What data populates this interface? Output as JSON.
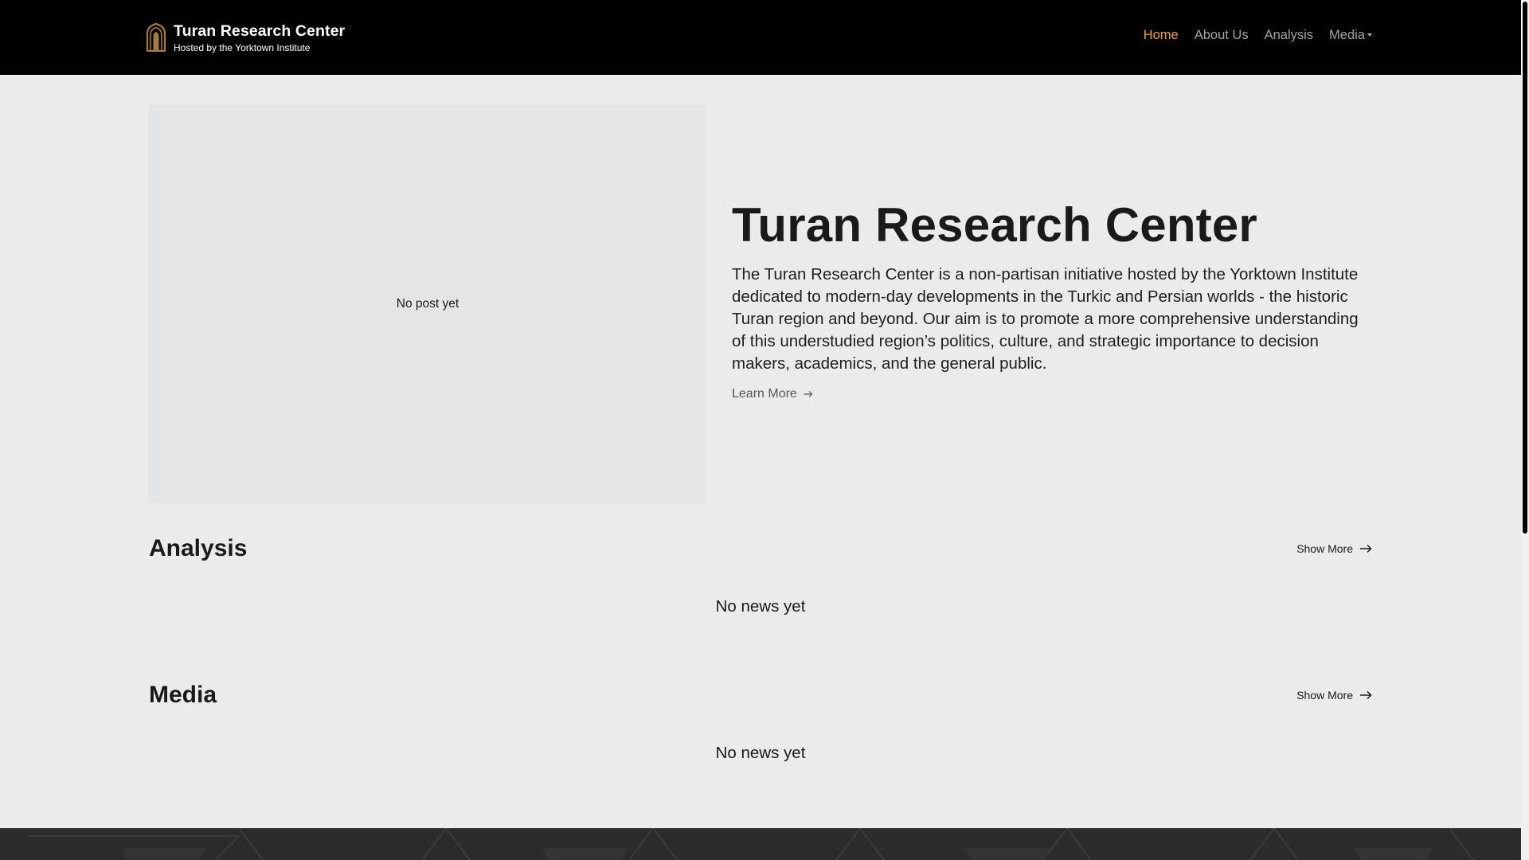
{
  "header": {
    "brand_title": "Turan Research Center",
    "brand_subtitle": "Hosted by the Yorktown Institute",
    "logo_icon": "arch-gate-icon",
    "nav": [
      {
        "label": "Home",
        "active": true
      },
      {
        "label": "About Us",
        "active": false
      },
      {
        "label": "Analysis",
        "active": false
      },
      {
        "label": "Media",
        "active": false,
        "dropdown": true
      }
    ]
  },
  "hero": {
    "image_placeholder": "No post yet",
    "title": "Turan Research Center",
    "description": "The Turan Research Center is a non-partisan initiative hosted by the Yorktown Institute dedicated to modern-day developments in the Turkic and Persian worlds - the historic Turan region and beyond. Our aim is to promote a more comprehensive understanding of this understudied region’s politics, culture, and strategic importance to decision makers, academics, and the general public.",
    "learn_more": "Learn More"
  },
  "sections": {
    "analysis": {
      "title": "Analysis",
      "show_more": "Show More",
      "empty": "No news yet"
    },
    "media": {
      "title": "Media",
      "show_more": "Show More",
      "empty": "No news yet"
    }
  },
  "colors": {
    "header_bg": "#000000",
    "accent": "#e8a23b",
    "nav_text": "#a3a3a3",
    "page_bg": "#ebebeb",
    "placeholder_bg": "#e4e5e7",
    "footer_bg": "#2b2b2b"
  }
}
